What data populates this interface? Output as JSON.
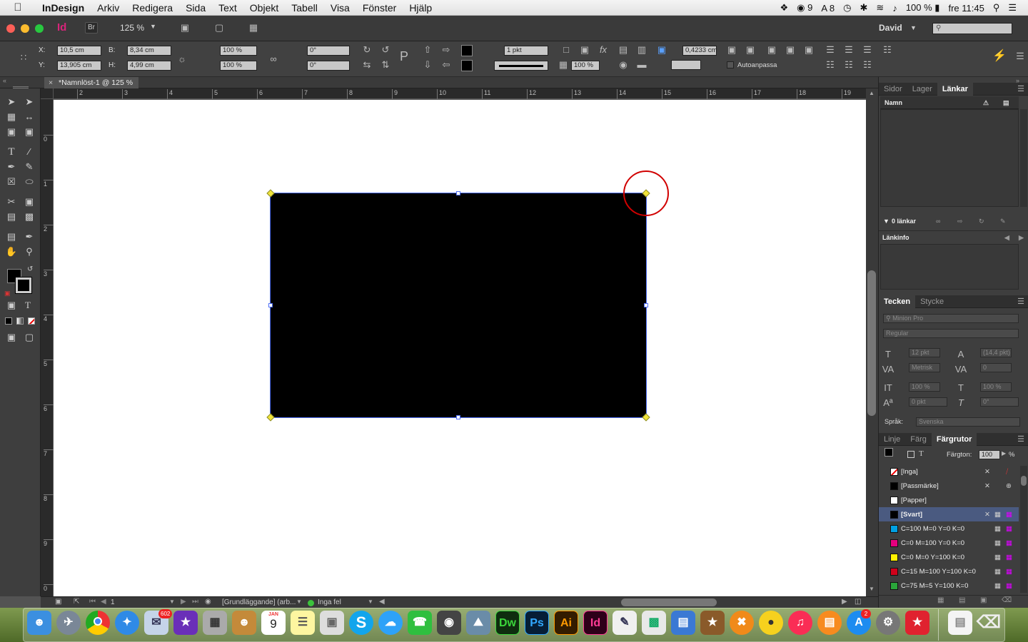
{
  "menubar": {
    "app": "InDesign",
    "items": [
      "Arkiv",
      "Redigera",
      "Sida",
      "Text",
      "Objekt",
      "Tabell",
      "Visa",
      "Fönster",
      "Hjälp"
    ],
    "status": {
      "badge1": "9",
      "badge2": "8",
      "battery": "100 %",
      "clock": "fre 11:45"
    }
  },
  "appbar": {
    "bridge": "Br",
    "zoom": "125 %",
    "user": "David"
  },
  "control": {
    "x_label": "X:",
    "x": "10,5 cm",
    "y_label": "Y:",
    "y": "13,905 cm",
    "w_label": "B:",
    "w": "8,34 cm",
    "h_label": "H:",
    "h": "4,99 cm",
    "scale_x": "100 %",
    "scale_y": "100 %",
    "rotate": "0°",
    "shear": "0°",
    "stroke_weight": "1 pkt",
    "opacity": "100 %",
    "offset": "0,4233 cm",
    "autofit": "Autoanpassa"
  },
  "document_tab": "*Namnlöst-1 @ 125 %",
  "ruler_h": [
    "2",
    "3",
    "4",
    "5",
    "6",
    "7",
    "8",
    "9",
    "10",
    "11",
    "12",
    "13",
    "14",
    "15",
    "16",
    "17",
    "18",
    "19"
  ],
  "ruler_v": [
    "0",
    "1",
    "2",
    "3",
    "4",
    "5",
    "6",
    "7",
    "8",
    "9",
    "0"
  ],
  "statusbar": {
    "page": "1",
    "profile": "[Grundläggande] (arb...",
    "errors": "Inga fel"
  },
  "links_panel": {
    "tabs": [
      "Sidor",
      "Lager",
      "Länkar"
    ],
    "active": "Länkar",
    "col_name": "Namn",
    "count": "0 länkar",
    "info": "Länkinfo"
  },
  "char_panel": {
    "tabs": [
      "Tecken",
      "Stycke"
    ],
    "font": "Minion Pro",
    "style": "Regular",
    "size": "12 pkt",
    "leading": "(14,4 pkt)",
    "kerning": "Metrisk",
    "tracking": "0",
    "vscale": "100 %",
    "hscale": "100 %",
    "baseline": "0 pkt",
    "skew": "0°",
    "lang_label": "Språk:",
    "lang": "Svenska"
  },
  "swatches_panel": {
    "tabs": [
      "Linje",
      "Färg",
      "Färgrutor"
    ],
    "tint_label": "Färgton:",
    "tint": "100",
    "tint_unit": "%",
    "swatches": [
      {
        "name": "[Inga]",
        "color": "#ffffff"
      },
      {
        "name": "[Passmärke]",
        "color": "#000000"
      },
      {
        "name": "[Papper]",
        "color": "#ffffff"
      },
      {
        "name": "[Svart]",
        "color": "#000000"
      },
      {
        "name": "C=100 M=0 Y=0 K=0",
        "color": "#00a0e3"
      },
      {
        "name": "C=0 M=100 Y=0 K=0",
        "color": "#e5007e"
      },
      {
        "name": "C=0 M=0 Y=100 K=0",
        "color": "#fff200"
      },
      {
        "name": "C=15 M=100 Y=100 K=0",
        "color": "#d0021b"
      },
      {
        "name": "C=75 M=5 Y=100 K=0",
        "color": "#2aa53a"
      }
    ]
  },
  "dock": {
    "badges": {
      "mail": "602",
      "calendar_day": "9",
      "calendar_month": "JAN",
      "appstore": "2"
    },
    "labels": {
      "dw": "Dw",
      "ps": "Ps",
      "ai": "Ai",
      "id": "Id",
      "skype": "S"
    }
  }
}
